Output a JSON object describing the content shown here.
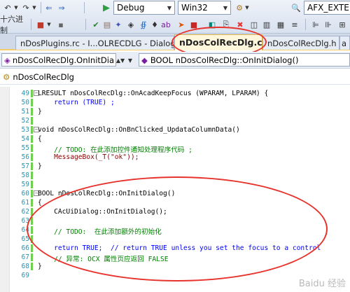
{
  "toolbar": {
    "row1": {
      "config_combo": "Debug",
      "platform_combo": "Win32",
      "macro_combo": "AFX_EXTEN"
    },
    "row2": {
      "hex_label": "十六进制"
    }
  },
  "tabs": [
    {
      "label": "nDosPlugins.rc - I...OLRECDLG - Dialog*",
      "active": false
    },
    {
      "label": "nDosColRecDlg.cpp",
      "active": true
    },
    {
      "label": "nDosColRecDlg.h",
      "active": false
    },
    {
      "label": "a",
      "active": false
    }
  ],
  "nav": {
    "class_combo": "nDosColRecDlg.OnInitDia",
    "member_combo": "BOOL nDosColRecDlg::OnInitDialog()"
  },
  "class_view": {
    "label": "nDosColRecDlg"
  },
  "code": {
    "l49": "LRESULT nDosColRecDlg::OnAcadKeepFocus (WPARAM, LPARAM) {",
    "l50": "    return (TRUE) ;",
    "l51": "}",
    "l52": "",
    "l53": "void nDosColRecDlg::OnBnClicked_UpdataColumnData()",
    "l54": "{",
    "l55": "    // TODO: 在此添加控件通知处理程序代码 ;",
    "l56": "    MessageBox(_T(\"ok\"));",
    "l57": "}",
    "l58": "",
    "l59": "",
    "l60": "BOOL nDosColRecDlg::OnInitDialog()",
    "l61": "{",
    "l62": "    CAcUiDialog::OnInitDialog();",
    "l63": "",
    "l64": "    // TODO:  在此添加额外的初始化",
    "l65": "",
    "l66": "    return TRUE;  // return TRUE unless you set the focus to a control",
    "l67": "    // 异常: OCX 属性页应返回 FALSE",
    "l68": "}",
    "l69": ""
  },
  "line_numbers": [
    "49",
    "50",
    "51",
    "52",
    "53",
    "54",
    "55",
    "56",
    "57",
    "58",
    "59",
    "60",
    "61",
    "62",
    "63",
    "64",
    "65",
    "66",
    "67",
    "68",
    "69"
  ],
  "watermark": "Baidu 经验",
  "colors": {
    "keyword": "#0000ff",
    "comment": "#008000",
    "line_number": "#2b91af",
    "annotation_ring": "#e8322c",
    "change_bar": "#6fcf4f"
  }
}
